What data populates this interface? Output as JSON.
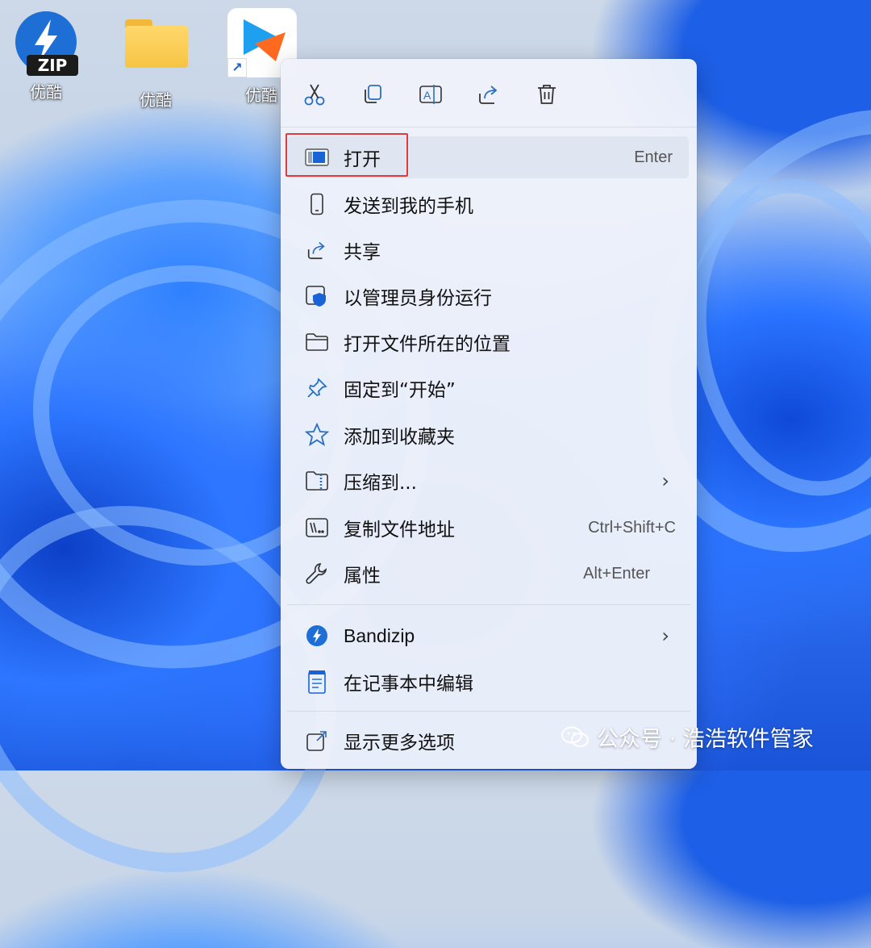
{
  "desktop": {
    "icons": [
      {
        "label": "优酷",
        "badge": "ZIP",
        "icon": "bandizip-zip-icon"
      },
      {
        "label": "优酷",
        "icon": "folder-icon"
      },
      {
        "label": "优酷",
        "icon": "youku-shortcut-icon",
        "shortcut_arrow": "↗"
      }
    ]
  },
  "context_menu": {
    "toolbar": [
      "cut-icon",
      "copy-icon",
      "rename-icon",
      "share-icon",
      "delete-icon"
    ],
    "items": [
      {
        "label": "打开",
        "shortcut": "Enter",
        "icon": "open-app-icon"
      },
      {
        "label": "发送到我的手机",
        "icon": "phone-icon"
      },
      {
        "label": "共享",
        "icon": "share-icon"
      },
      {
        "label": "以管理员身份运行",
        "icon": "admin-shield-icon"
      },
      {
        "label": "打开文件所在的位置",
        "icon": "folder-outline-icon"
      },
      {
        "label": "固定到“开始”",
        "icon": "pin-icon"
      },
      {
        "label": "添加到收藏夹",
        "icon": "star-icon"
      },
      {
        "label": "压缩到...",
        "icon": "zip-folder-icon",
        "submenu": "›"
      },
      {
        "label": "复制文件地址",
        "shortcut": "Ctrl+Shift+C",
        "icon": "copy-path-icon"
      },
      {
        "label": "属性",
        "shortcut": "Alt+Enter",
        "icon": "wrench-icon"
      },
      {
        "label": "Bandizip",
        "icon": "bandizip-icon",
        "submenu": "›"
      },
      {
        "label": "在记事本中编辑",
        "icon": "notepad-icon"
      },
      {
        "label": "显示更多选项",
        "icon": "more-options-icon"
      }
    ]
  },
  "watermark": {
    "text": "公众号 · 浩浩软件管家"
  },
  "colors": {
    "highlight_border": "#e03a3a",
    "accent": "#1a63d6"
  }
}
